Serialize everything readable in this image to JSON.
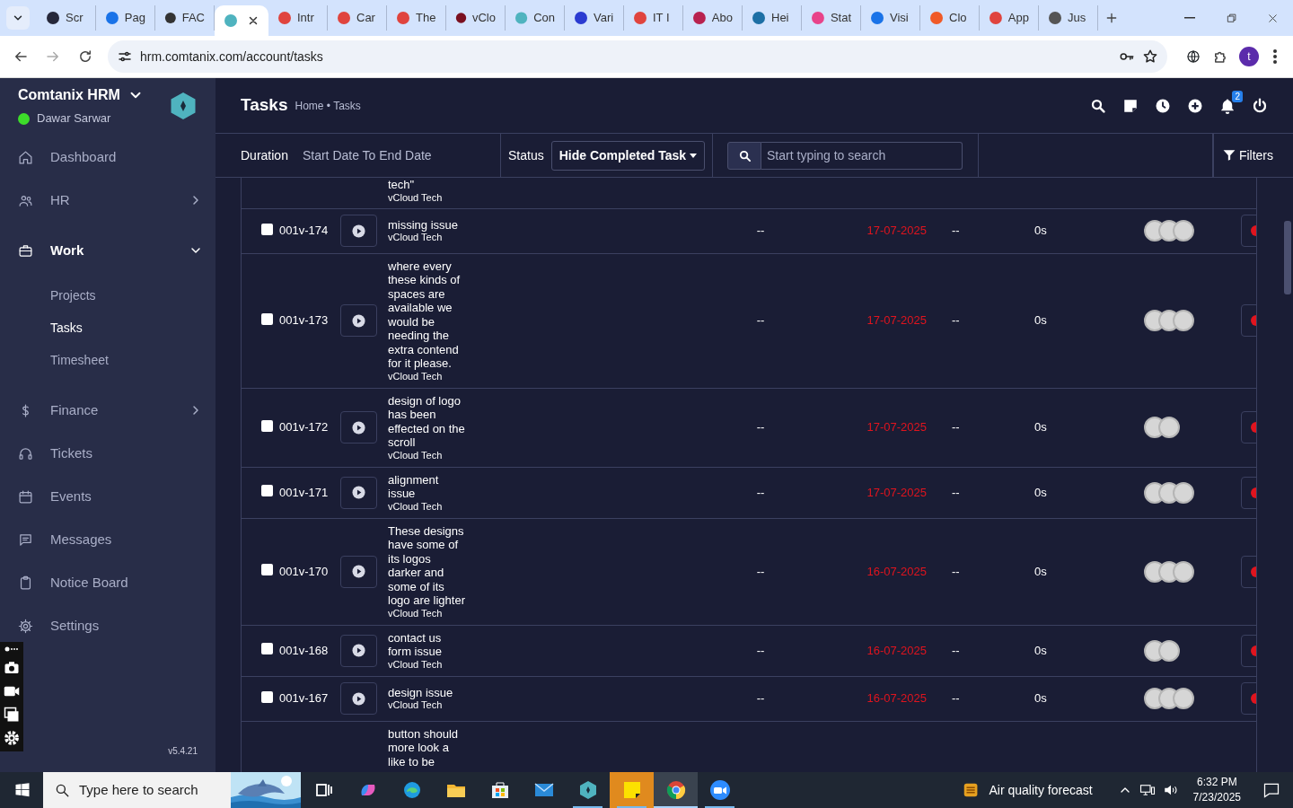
{
  "browser": {
    "tabs": [
      {
        "label": "Scr",
        "selected": false,
        "color": "#26283a"
      },
      {
        "label": "Pag",
        "selected": false,
        "color": "#1a73e8"
      },
      {
        "label": "FAC",
        "selected": false,
        "color": "#333333"
      },
      {
        "selected": true,
        "color": "#4fb3bf"
      },
      {
        "label": "Intr",
        "selected": false,
        "color": "#e0443e"
      },
      {
        "label": "Car",
        "selected": false,
        "color": "#e0443e"
      },
      {
        "label": "The",
        "selected": false,
        "color": "#e0443e"
      },
      {
        "label": "vClo",
        "selected": false,
        "color": "#7a1020"
      },
      {
        "label": "Con",
        "selected": false,
        "color": "#4fb3bf"
      },
      {
        "label": "Vari",
        "selected": false,
        "color": "#2b3bd1"
      },
      {
        "label": "IT I",
        "selected": false,
        "color": "#e0443e"
      },
      {
        "label": "Abo",
        "selected": false,
        "color": "#b8224f"
      },
      {
        "label": "Hei",
        "selected": false,
        "color": "#1d6fa5"
      },
      {
        "label": "Stat",
        "selected": false,
        "color": "#e8438a"
      },
      {
        "label": "Visi",
        "selected": false,
        "color": "#1a73e8"
      },
      {
        "label": "Clo",
        "selected": false,
        "color": "#f05a28"
      },
      {
        "label": "App",
        "selected": false,
        "color": "#e0443e"
      },
      {
        "label": "Jus",
        "selected": false,
        "color": "#555555"
      }
    ],
    "url": "hrm.comtanix.com/account/tasks",
    "profile": "t"
  },
  "sidebar": {
    "brand": "Comtanix HRM",
    "user": "Dawar Sarwar",
    "online": true,
    "items": [
      {
        "label": "Dashboard",
        "selected": false
      },
      {
        "label": "HR",
        "selected": false,
        "expanded": false
      },
      {
        "label": "Work",
        "selected": true,
        "expanded": true,
        "children": [
          {
            "label": "Projects",
            "selected": false
          },
          {
            "label": "Tasks",
            "selected": true
          },
          {
            "label": "Timesheet",
            "selected": false
          }
        ]
      },
      {
        "label": "Finance",
        "selected": false,
        "expanded": false
      },
      {
        "label": "Tickets",
        "selected": false
      },
      {
        "label": "Events",
        "selected": false
      },
      {
        "label": "Messages",
        "selected": false
      },
      {
        "label": "Notice Board",
        "selected": false
      },
      {
        "label": "Settings",
        "selected": false
      }
    ],
    "version": "v5.4.21"
  },
  "header": {
    "title": "Tasks",
    "breadcrumb": "Home • Tasks",
    "notifications": "2"
  },
  "filters": {
    "duration_label": "Duration",
    "duration_value": "Start Date To End Date",
    "status_label": "Status",
    "status_value": "Hide Completed Task",
    "search_placeholder": "Start typing to search",
    "filters_button": "Filters"
  },
  "tasks": [
    {
      "kind": "partial",
      "title": "tech\"",
      "company": "vCloud Tech"
    },
    {
      "kind": "task",
      "checked": false,
      "id": "001v-174",
      "title": "missing issue",
      "company": "vCloud Tech",
      "start": "--",
      "due": "17-07-2025",
      "end": "--",
      "time": "0s",
      "assignees": [
        {
          "kind": "avatar"
        },
        {
          "kind": "avatar"
        },
        {
          "kind": "avatar"
        }
      ]
    },
    {
      "kind": "task",
      "checked": false,
      "id": "001v-173",
      "title": "where every these kinds of spaces are available we would be needing the extra contend for it please.",
      "company": "vCloud Tech",
      "start": "--",
      "due": "17-07-2025",
      "end": "--",
      "time": "0s",
      "assignees": [
        {
          "kind": "avatar"
        },
        {
          "kind": "avatar"
        },
        {
          "kind": "avatar"
        }
      ]
    },
    {
      "kind": "task",
      "checked": false,
      "id": "001v-172",
      "title": "design of logo has been effected on the scroll",
      "company": "vCloud Tech",
      "start": "--",
      "due": "17-07-2025",
      "end": "--",
      "time": "0s",
      "assignees": [
        {
          "kind": "avatar"
        },
        {
          "kind": "avatar"
        }
      ]
    },
    {
      "kind": "task",
      "checked": false,
      "id": "001v-171",
      "title": "alignment issue",
      "company": "vCloud Tech",
      "start": "--",
      "due": "17-07-2025",
      "end": "--",
      "time": "0s",
      "assignees": [
        {
          "kind": "avatar"
        },
        {
          "kind": "avatar"
        },
        {
          "kind": "avatar"
        }
      ]
    },
    {
      "kind": "task",
      "checked": false,
      "id": "001v-170",
      "title": "These designs have some of its logos darker and some of its logo are lighter",
      "company": "vCloud Tech",
      "start": "--",
      "due": "16-07-2025",
      "end": "--",
      "time": "0s",
      "assignees": [
        {
          "kind": "avatar"
        },
        {
          "kind": "avatar"
        },
        {
          "kind": "avatar"
        }
      ]
    },
    {
      "kind": "task",
      "checked": false,
      "id": "001v-168",
      "title": "contact us form issue",
      "company": "vCloud Tech",
      "start": "--",
      "due": "16-07-2025",
      "end": "--",
      "time": "0s",
      "assignees": [
        {
          "kind": "avatar"
        },
        {
          "kind": "avatar"
        }
      ]
    },
    {
      "kind": "task",
      "checked": false,
      "id": "001v-167",
      "title": "design issue",
      "company": "vCloud Tech",
      "start": "--",
      "due": "16-07-2025",
      "end": "--",
      "time": "0s",
      "assignees": [
        {
          "kind": "avatar"
        },
        {
          "kind": "avatar"
        },
        {
          "kind": "avatar"
        }
      ]
    },
    {
      "kind": "cut",
      "title": "button should more look a like to be"
    }
  ],
  "taskbar": {
    "search_placeholder": "Type here to search",
    "apps": [
      {
        "kind": "taskview",
        "running": false,
        "selected": false
      },
      {
        "kind": "copilot",
        "running": false,
        "selected": false
      },
      {
        "kind": "edge",
        "running": false,
        "selected": false
      },
      {
        "kind": "explorer",
        "running": false,
        "selected": false
      },
      {
        "kind": "store",
        "running": false,
        "selected": false
      },
      {
        "kind": "mail",
        "running": false,
        "selected": false
      },
      {
        "kind": "hrm",
        "running": true,
        "selected": false
      },
      {
        "kind": "notes",
        "running": true,
        "selected": false,
        "attention": true
      },
      {
        "kind": "chrome",
        "running": true,
        "selected": true
      },
      {
        "kind": "zoom",
        "running": true,
        "selected": false
      }
    ],
    "weather": "Air quality forecast",
    "time": "6:32 PM",
    "date": "7/23/2025"
  }
}
